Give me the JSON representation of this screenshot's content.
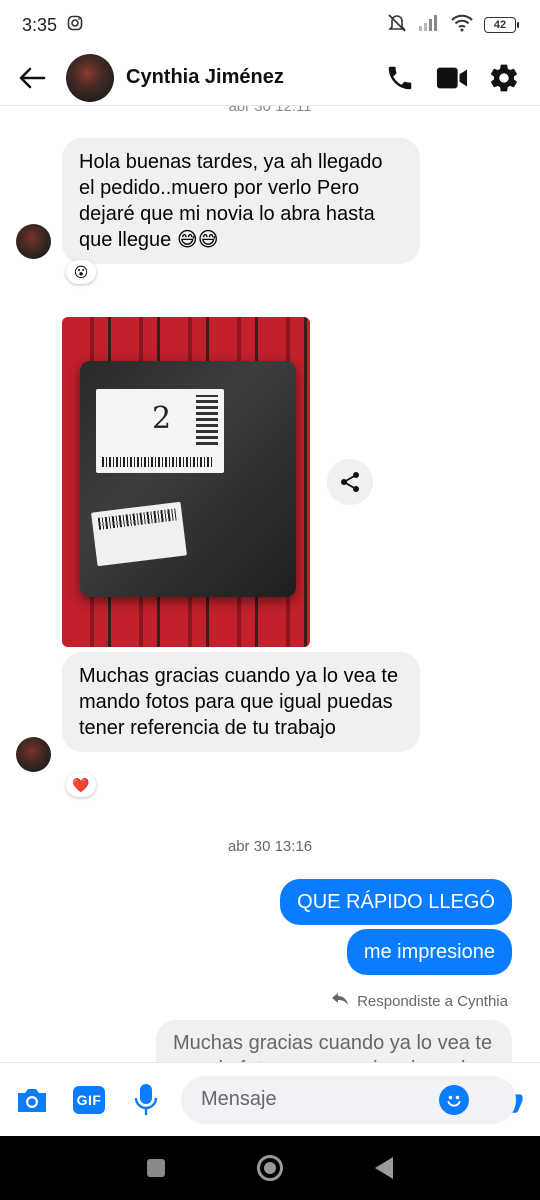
{
  "status_bar": {
    "time": "3:35",
    "battery": "42"
  },
  "header": {
    "contact_name": "Cynthia Jiménez"
  },
  "chat": {
    "partial_timestamp": "abr 30 12:11",
    "messages": [
      {
        "text": "Hola buenas tardes, ya ah llegado el pedido..muero por verlo Pero dejaré que mi novia lo abra hasta que llegue 😅😅",
        "reaction": "😮"
      },
      {
        "text": "Muchas gracias cuando ya lo vea te mando fotos para que igual puedas tener referencia de tu trabajo",
        "reaction": "❤️"
      }
    ],
    "timestamp": "abr 30 13:16",
    "outgoing": [
      "QUE RÁPIDO LLEGÓ",
      "me impresione"
    ],
    "reply_note": "Respondiste a Cynthia",
    "quoted_text": "Muchas gracias cuando ya lo vea te mando fotos para que igual puedas tener referencia de tu trabajo"
  },
  "composer": {
    "gif_label": "GIF",
    "placeholder": "Mensaje"
  },
  "colors": {
    "accent": "#0a7cff",
    "incoming_bubble": "#f0f0f0"
  }
}
